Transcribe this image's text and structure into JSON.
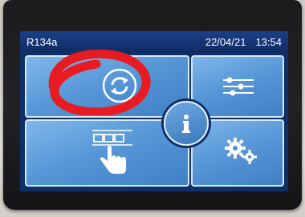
{
  "status_bar": {
    "refrigerant": "R134a",
    "date": "22/04/21",
    "time": "13:54"
  },
  "tiles": [
    {
      "icon": "sync-icon"
    },
    {
      "icon": "sliders-icon"
    },
    {
      "icon": "touch-keypad-icon"
    },
    {
      "icon": "gears-icon"
    }
  ],
  "info_button": {
    "icon": "info-icon"
  },
  "annotation": {
    "icon": "red-circle-annotation"
  },
  "colors": {
    "screen_background": "#0f2f67",
    "tile_blue": "#5898d8",
    "tile_border": "#d7e9fb",
    "annotation_red": "#e81b22",
    "bezel": "#1b1b1d"
  }
}
